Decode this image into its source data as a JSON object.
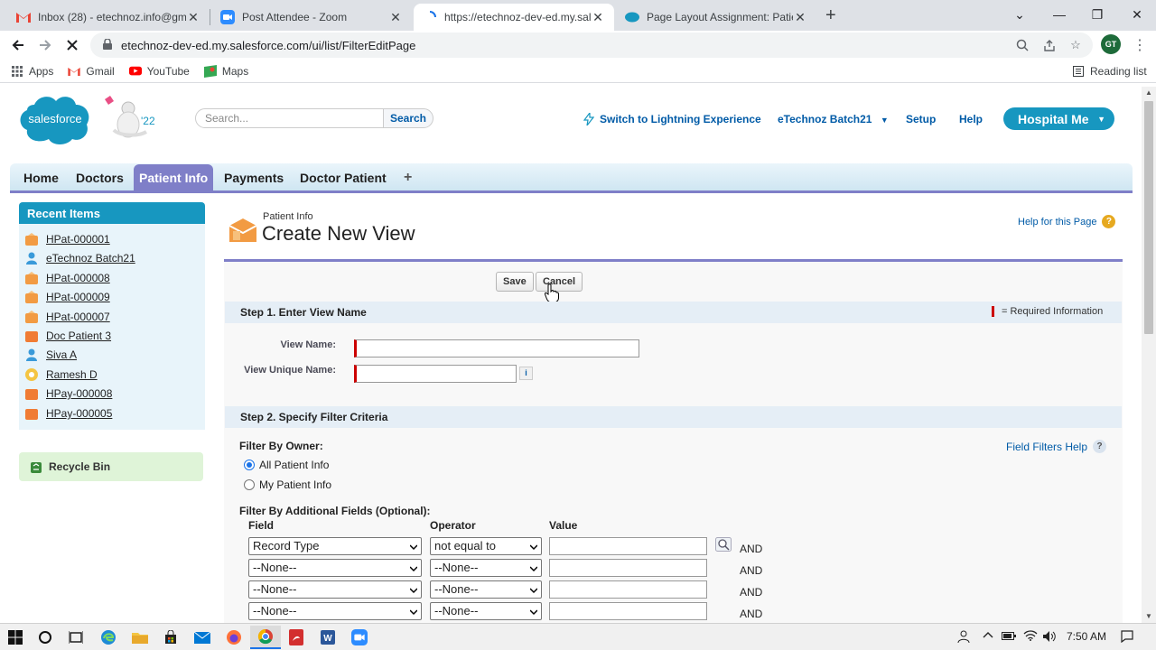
{
  "browser": {
    "tabs": [
      {
        "title": "Inbox (28) - etechnoz.info@gmai",
        "icon": "gmail-icon"
      },
      {
        "title": "Post Attendee - Zoom",
        "icon": "zoom-icon"
      },
      {
        "title": "https://etechnoz-dev-ed.my.sale",
        "icon": "loading-icon"
      },
      {
        "title": "Page Layout Assignment: Patient",
        "icon": "salesforce-icon"
      }
    ],
    "url": "etechnoz-dev-ed.my.salesforce.com/ui/list/FilterEditPage",
    "profile_initials": "GT",
    "bookmarks": [
      "Apps",
      "Gmail",
      "YouTube",
      "Maps"
    ],
    "reading_list": "Reading list"
  },
  "header": {
    "logo_text": "salesforce",
    "mascot_text": "'22",
    "search_placeholder": "Search...",
    "search_button": "Search",
    "lightning_link": "Switch to Lightning Experience",
    "user_menu": "eTechnoz Batch21",
    "setup": "Setup",
    "help": "Help",
    "app_name": "Hospital Me"
  },
  "nav_tabs": [
    "Home",
    "Doctors",
    "Patient Info",
    "Payments",
    "Doctor Patient",
    "+"
  ],
  "active_tab": "Patient Info",
  "sidebar": {
    "title": "Recent Items",
    "items": [
      {
        "label": "HPat-000001",
        "icon": "patient-icon"
      },
      {
        "label": "eTechnoz Batch21",
        "icon": "user-icon"
      },
      {
        "label": "HPat-000008",
        "icon": "patient-icon"
      },
      {
        "label": "HPat-000009",
        "icon": "patient-icon"
      },
      {
        "label": "HPat-000007",
        "icon": "patient-icon"
      },
      {
        "label": "Doc Patient 3",
        "icon": "doc-patient-icon"
      },
      {
        "label": "Siva A",
        "icon": "user-icon"
      },
      {
        "label": "Ramesh D",
        "icon": "doctor-icon"
      },
      {
        "label": "HPay-000008",
        "icon": "payment-icon"
      },
      {
        "label": "HPay-000005",
        "icon": "payment-icon"
      }
    ],
    "recycle_bin": "Recycle Bin"
  },
  "page": {
    "object_type": "Patient Info",
    "title": "Create New View",
    "help_link": "Help for this Page",
    "save_button": "Save",
    "cancel_button": "Cancel",
    "step1": {
      "heading": "Step 1. Enter View Name",
      "required_info": "= Required Information",
      "view_name_label": "View Name:",
      "view_name_value": "",
      "unique_name_label": "View Unique Name:",
      "unique_name_value": ""
    },
    "step2": {
      "heading": "Step 2. Specify Filter Criteria",
      "filter_by_owner": "Filter By Owner:",
      "owner_options": [
        "All Patient Info",
        "My Patient Info"
      ],
      "owner_selected": "All Patient Info",
      "field_filters_help": "Field Filters Help",
      "additional_fields": "Filter By Additional Fields (Optional):",
      "columns": [
        "Field",
        "Operator",
        "Value"
      ],
      "rows": [
        {
          "field": "Record Type",
          "operator": "not equal to",
          "value": "",
          "conj": "AND"
        },
        {
          "field": "--None--",
          "operator": "--None--",
          "value": "",
          "conj": "AND"
        },
        {
          "field": "--None--",
          "operator": "--None--",
          "value": "",
          "conj": "AND"
        },
        {
          "field": "--None--",
          "operator": "--None--",
          "value": "",
          "conj": "AND"
        }
      ]
    }
  },
  "taskbar": {
    "time": "7:50 AM"
  },
  "colors": {
    "salesforce_blue": "#1797c0",
    "tab_active": "#7f7fc8",
    "link": "#015ba7",
    "required": "#c00"
  }
}
